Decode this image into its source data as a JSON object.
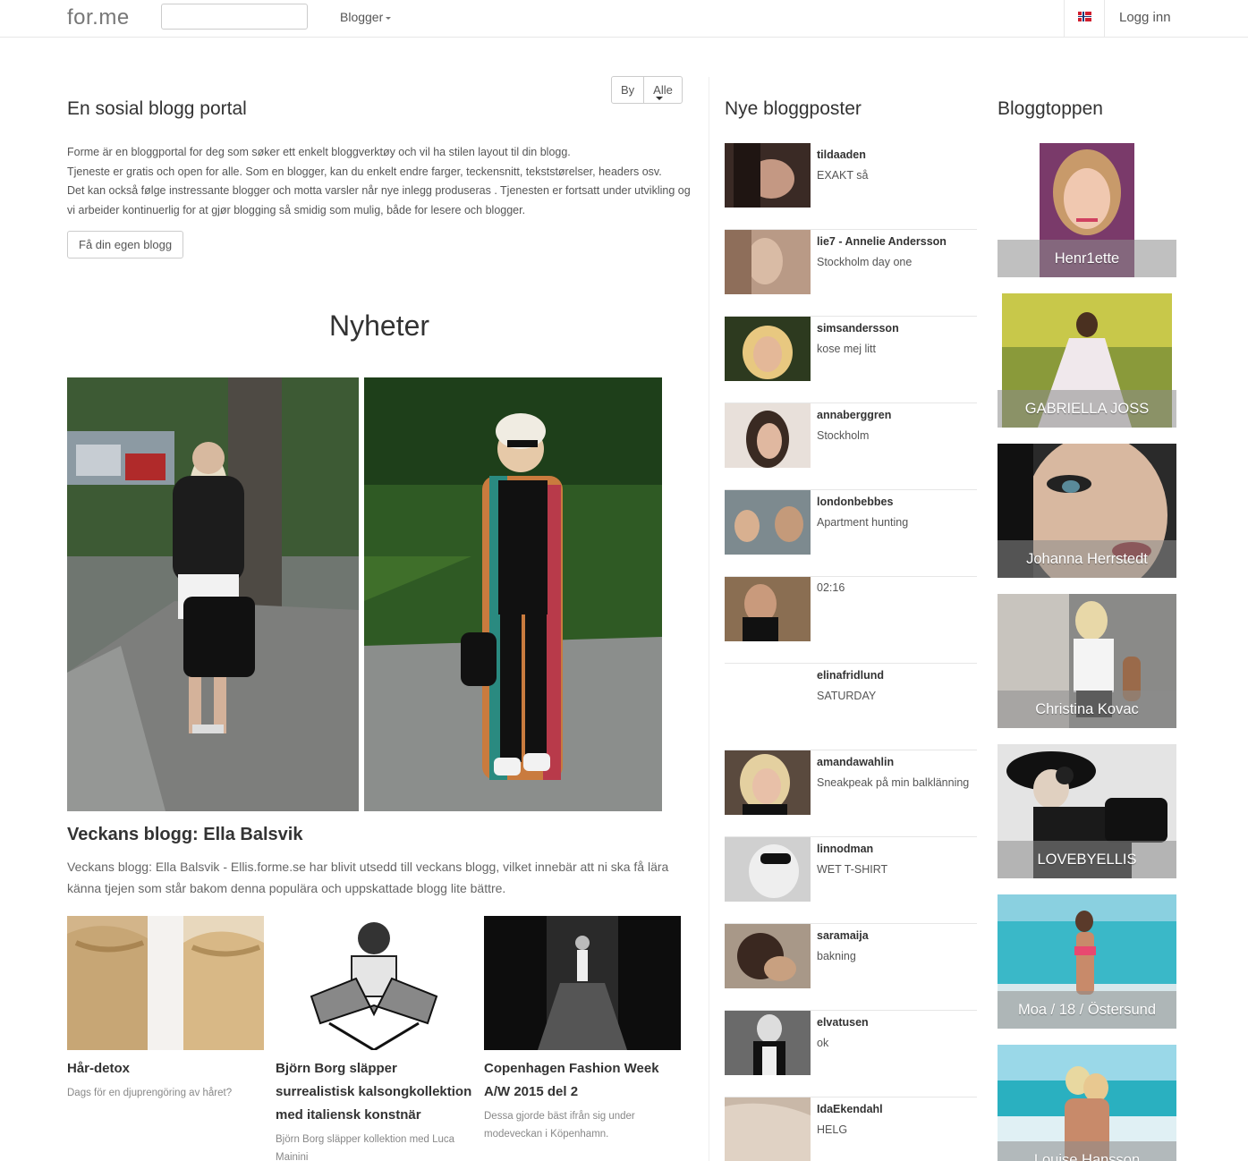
{
  "navbar": {
    "brand": "for.me",
    "search_value": "",
    "blogger_label": "Blogger",
    "language_flag": "norway-flag-icon",
    "login_label": "Logg inn"
  },
  "filter": {
    "city_label": "By",
    "selected": "Alle"
  },
  "intro": {
    "title": "En sosial blogg portal",
    "paragraph1": "Forme är en bloggportal for deg som søker ett enkelt bloggverktøy och vil ha stilen layout til din blogg.",
    "paragraph2": "Tjeneste er gratis och open for alle. Som en blogger, kan du enkelt endre farger, teckensnitt, tekststørelser, headers osv.",
    "paragraph3": "Det kan också følge instressante blogger och motta varsler når nye inlegg produseras . Tjenesten er fortsatt under utvikling og vi arbeider kontinuerlig for at gjør blogging så smidig som mulig, både for lesere och blogger.",
    "cta_label": "Få din egen blogg"
  },
  "news": {
    "heading": "Nyheter",
    "feature_title": "Veckans blogg: Ella Balsvik",
    "feature_text": "Veckans blogg: Ella Balsvik - Ellis.forme.se har blivit utsedd till veckans blogg, vilket innebär att ni ska få lära känna tjejen som står bakom denna populära och uppskattade blogg lite bättre.",
    "articles": [
      {
        "title": "Hår-detox",
        "desc": "Dags för en djuprengöring av håret?"
      },
      {
        "title": "Björn Borg släpper surrealistisk kalsongkollektion med italiensk konstnär",
        "desc": "Björn Borg släpper kollektion med Luca Mainini"
      },
      {
        "title": "Copenhagen Fashion Week A/W 2015 del 2",
        "desc": "Dessa gjorde bäst ifrån sig under modeveckan i Köpenhamn."
      }
    ]
  },
  "posts": {
    "heading": "Nye bloggposter",
    "items": [
      {
        "user": "tildaaden",
        "text": "EXAKT så"
      },
      {
        "user": "lie7 - Annelie Andersson",
        "text": "Stockholm day one"
      },
      {
        "user": "simsandersson",
        "text": "kose mej litt"
      },
      {
        "user": "annaberggren",
        "text": "Stockholm"
      },
      {
        "user": "londonbebbes",
        "text": "Apartment hunting"
      },
      {
        "user": "",
        "text": "02:16"
      },
      {
        "user": "elinafridlund",
        "text": "SATURDAY"
      },
      {
        "user": "amandawahlin",
        "text": "Sneakpeak på min balklänning"
      },
      {
        "user": "linnodman",
        "text": "WET T-SHIRT"
      },
      {
        "user": "saramaija",
        "text": "bakning"
      },
      {
        "user": "elvatusen",
        "text": "ok"
      },
      {
        "user": "IdaEkendahl",
        "text": "HELG"
      }
    ]
  },
  "top": {
    "heading": "Bloggtoppen",
    "items": [
      {
        "name": "Henr1ette"
      },
      {
        "name": "GABRIELLA JOSS"
      },
      {
        "name": "Johanna Herrstedt"
      },
      {
        "name": "Christina Kovac"
      },
      {
        "name": "LOVEBYELLIS"
      },
      {
        "name": "Moa / 18 / Östersund"
      },
      {
        "name": "Louise Hansson"
      }
    ]
  }
}
